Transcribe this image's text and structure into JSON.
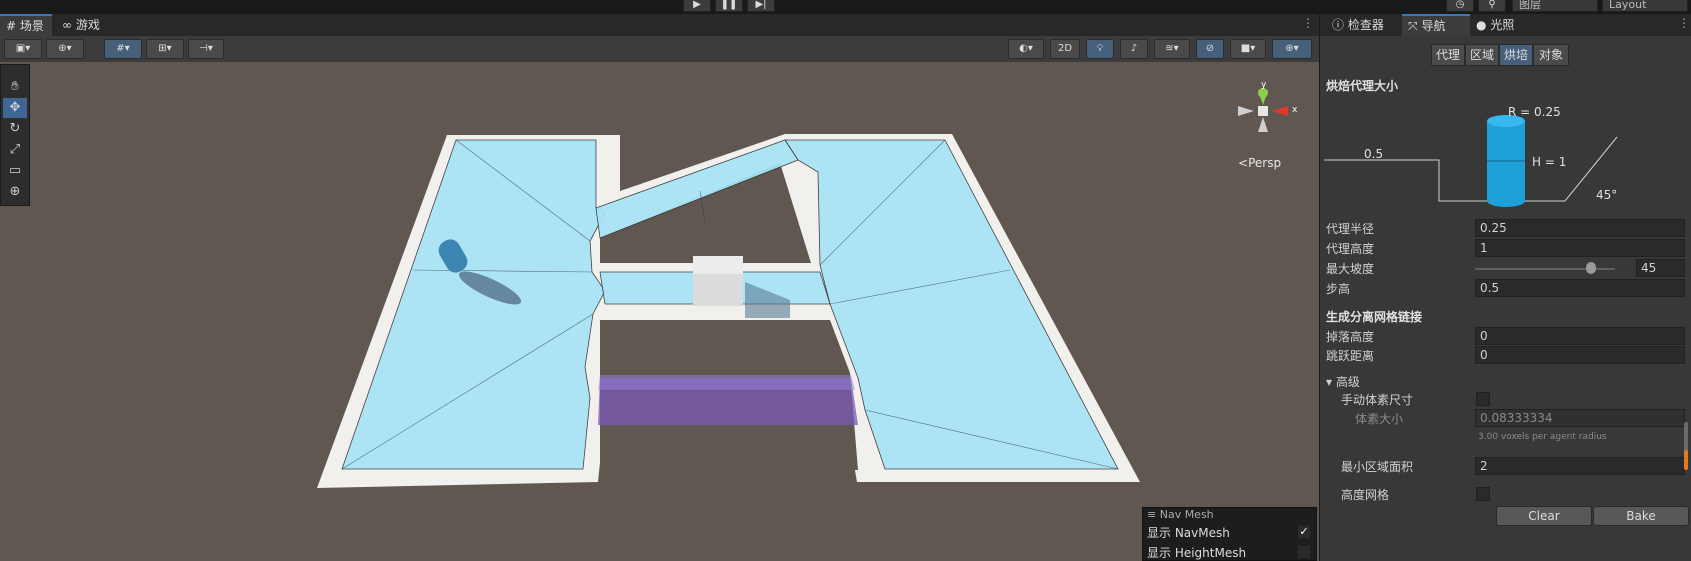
{
  "toolbar": {
    "layers_label": "图层",
    "layout_label": "Layout"
  },
  "left_tabs": [
    {
      "label": "场景"
    },
    {
      "label": "游戏"
    }
  ],
  "right_tabs": [
    {
      "label": "检查器"
    },
    {
      "label": "导航"
    },
    {
      "label": "光照"
    }
  ],
  "scenebar": {
    "mode_2d": "2D"
  },
  "gizmo": {
    "y": "y",
    "x": "x",
    "persp": "Persp"
  },
  "navmesh_overlay": {
    "title": "Nav Mesh",
    "items": [
      {
        "label": "显示 NavMesh",
        "checked": true
      },
      {
        "label": "显示 HeightMesh",
        "checked": false
      }
    ]
  },
  "navigation": {
    "sub_tabs": [
      {
        "label": "代理"
      },
      {
        "label": "区域"
      },
      {
        "label": "烘培"
      },
      {
        "label": "对象"
      }
    ],
    "baked_agent_size": {
      "header": "烘焙代理大小",
      "radius_label": "R = 0.25",
      "height_label": "H = 1",
      "step_label": "0.5",
      "slope_label": "45°"
    },
    "fields": {
      "agent_radius": {
        "label": "代理半径",
        "value": "0.25"
      },
      "agent_height": {
        "label": "代理高度",
        "value": "1"
      },
      "max_slope": {
        "label": "最大坡度",
        "value": "45",
        "slider_fraction": 0.75
      },
      "step_height": {
        "label": "步高",
        "value": "0.5"
      }
    },
    "offmesh": {
      "header": "生成分离网格链接",
      "drop_height": {
        "label": "掉落高度",
        "value": "0"
      },
      "jump_distance": {
        "label": "跳跃距离",
        "value": "0"
      }
    },
    "advanced": {
      "header": "高级",
      "manual_voxel": {
        "label": "手动体素尺寸"
      },
      "voxel_size": {
        "label": "体素大小",
        "value": "0.08333334",
        "hint": "3.00 voxels per agent radius"
      },
      "min_region_area": {
        "label": "最小区域面积",
        "value": "2"
      },
      "height_mesh": {
        "label": "高度网格"
      }
    },
    "buttons": {
      "clear": "Clear",
      "bake": "Bake"
    }
  },
  "colors": {
    "accent": "#3a79bb",
    "navmesh": "#a8e4f6",
    "nav_area_purple": "#7c58b4"
  }
}
